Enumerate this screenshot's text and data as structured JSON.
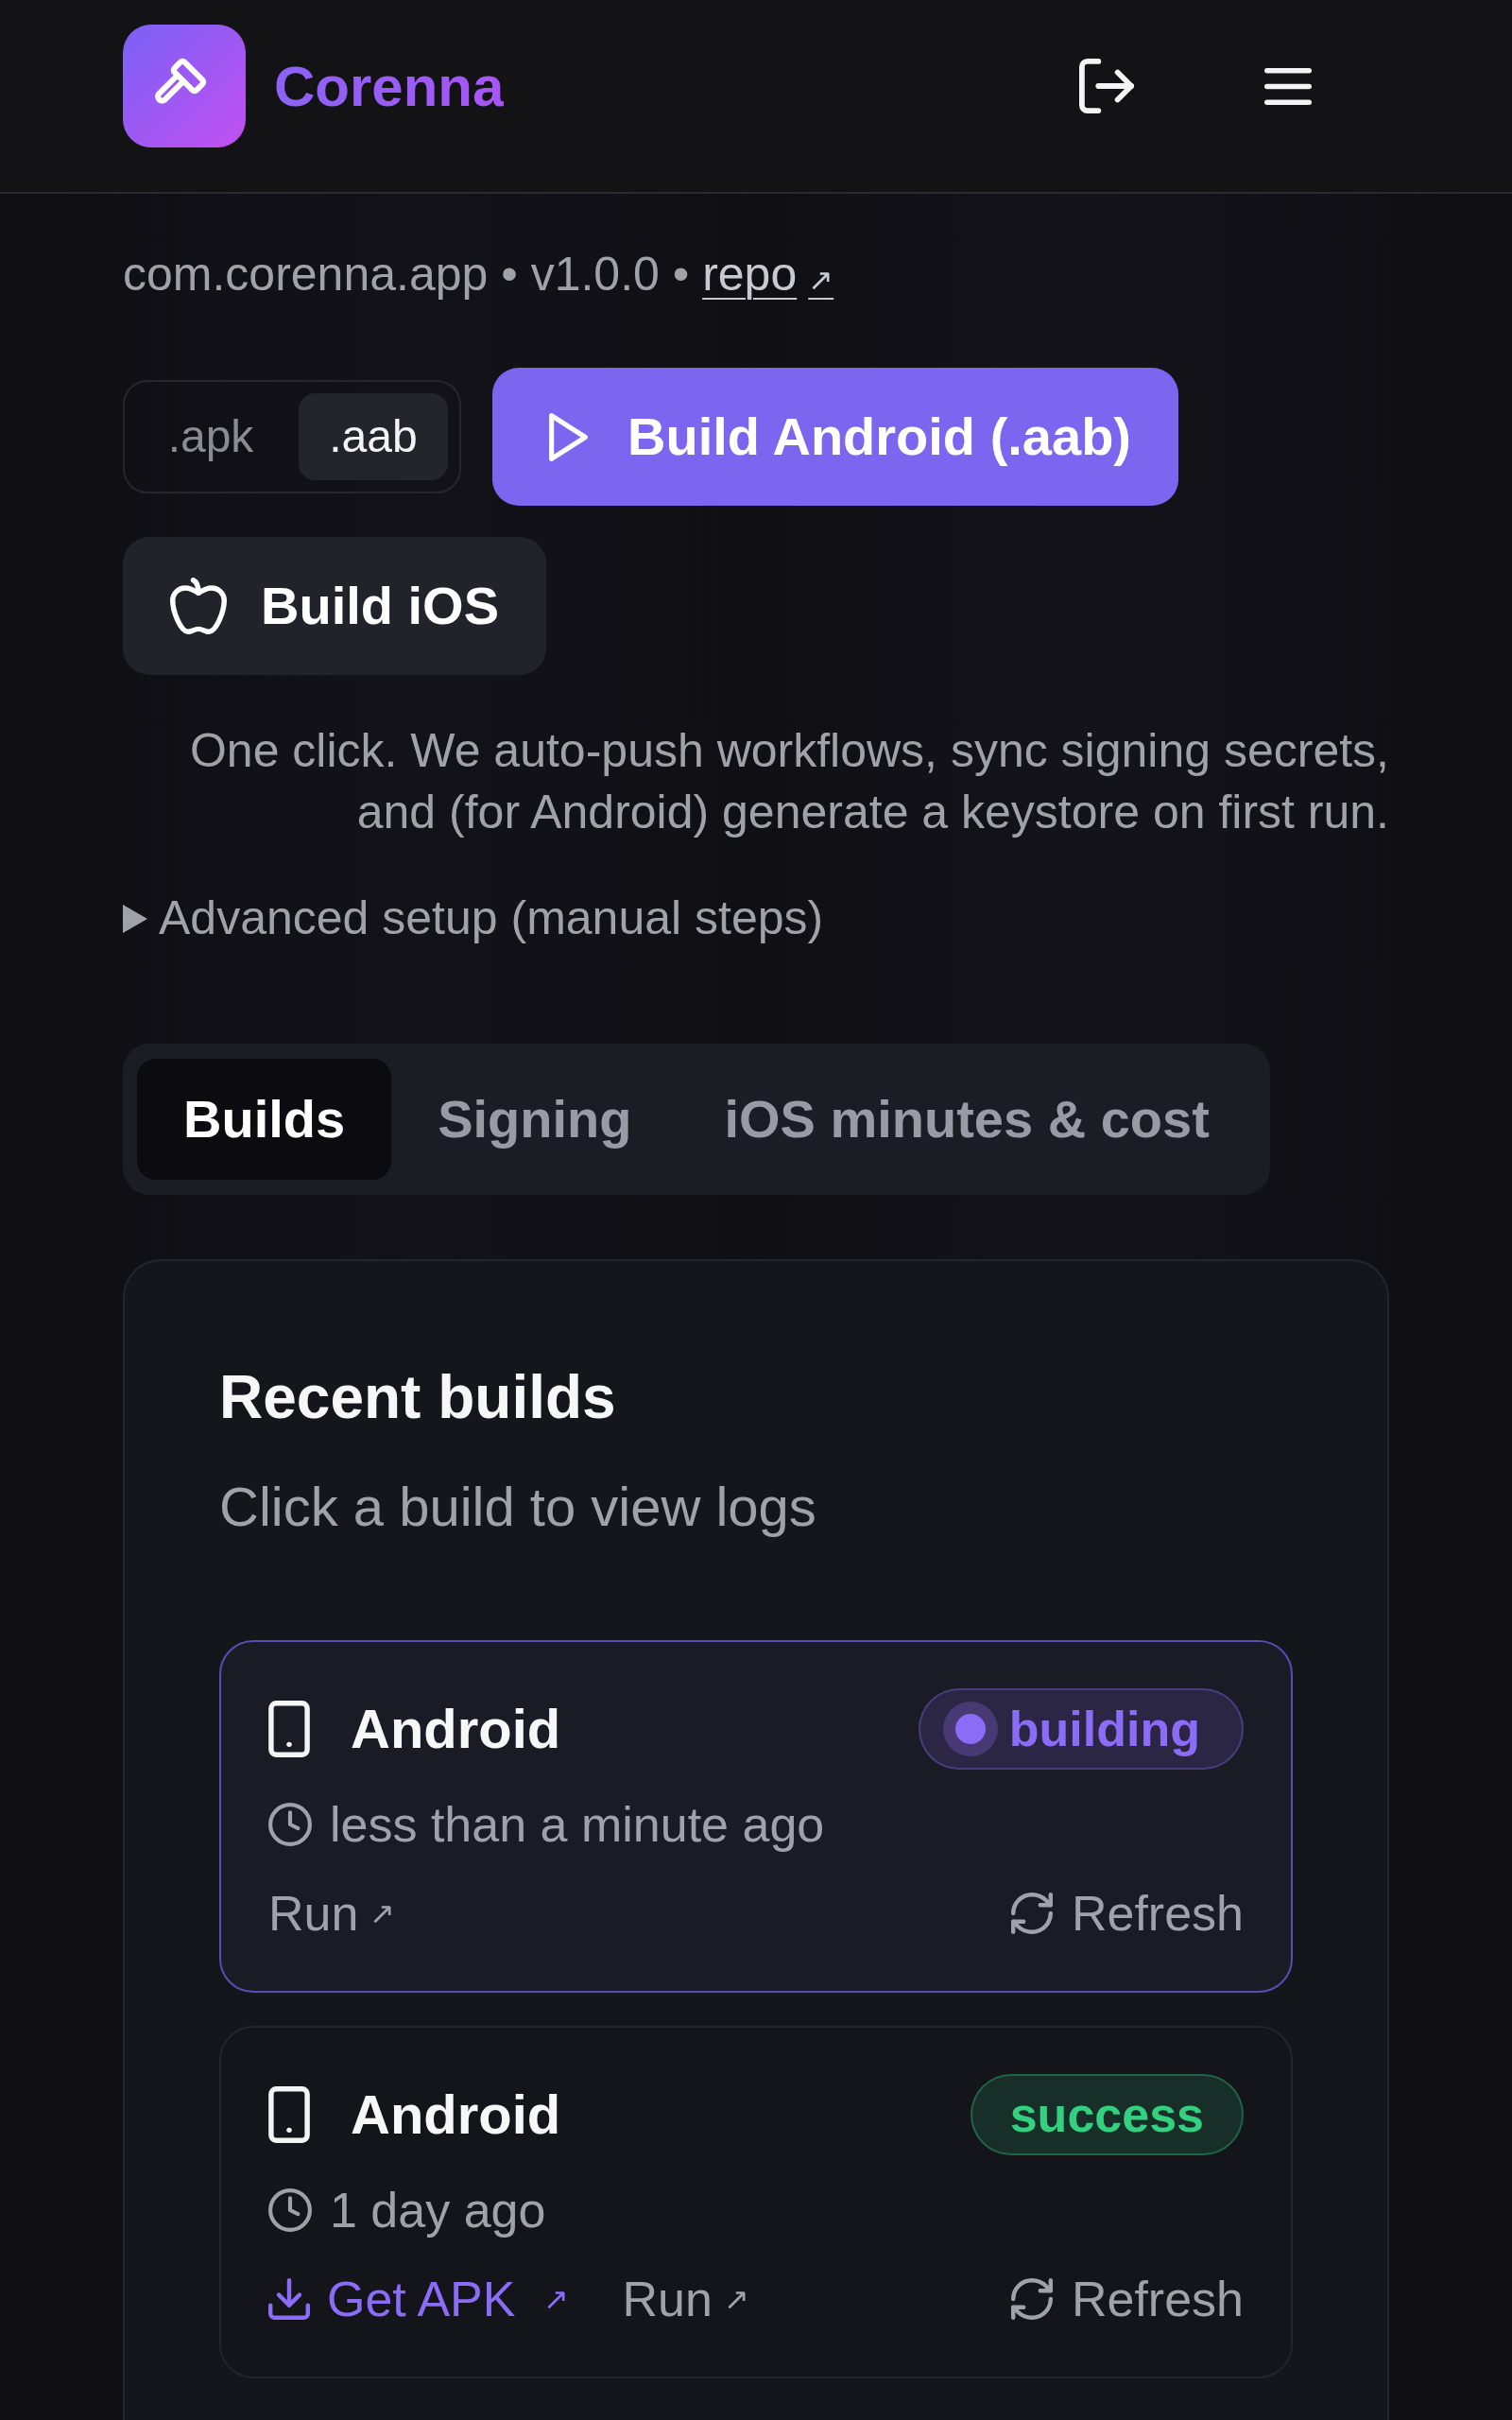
{
  "header": {
    "brand": "Corenna"
  },
  "app": {
    "meta": "com.corenna.app • v1.0.0 •",
    "repo_link": {
      "label": "repo",
      "arrow": "↗"
    }
  },
  "format_toggle": [
    {
      "label": ".apk",
      "selected": false
    },
    {
      "label": ".aab",
      "selected": true
    }
  ],
  "build_buttons": [
    {
      "kind": "android",
      "label": "Build Android (.aab)"
    },
    {
      "kind": "ios",
      "label": "Build iOS"
    }
  ],
  "note": "One click. We auto-push workflows, sync signing secrets, and (for Android) generate a keystore on first run.",
  "advanced_setup": {
    "label": "Advanced setup (manual steps)",
    "expanded": false
  },
  "tabs": [
    {
      "label": "Builds",
      "selected": true
    },
    {
      "label": "Signing",
      "selected": false
    },
    {
      "label": "iOS minutes & cost",
      "selected": false
    }
  ],
  "recent_builds": {
    "title": "Recent builds",
    "subtitle": "Click a build to view logs",
    "items": [
      {
        "platform": "Android",
        "selected": true,
        "status": {
          "label": "building",
          "kind": "running",
          "color": "#8b6cf6"
        },
        "time": "less than a minute ago",
        "links": [
          {
            "kind": "run",
            "label": "Run",
            "arrow": "↗"
          }
        ],
        "refresh": "Refresh"
      },
      {
        "platform": "Android",
        "selected": false,
        "status": {
          "label": "success",
          "kind": "done",
          "color": "#34d07f"
        },
        "time": "1 day ago",
        "links": [
          {
            "kind": "download",
            "label": "Get APK",
            "arrow": "↗"
          },
          {
            "kind": "run",
            "label": "Run",
            "arrow": "↗"
          }
        ],
        "refresh": "Refresh"
      }
    ]
  }
}
